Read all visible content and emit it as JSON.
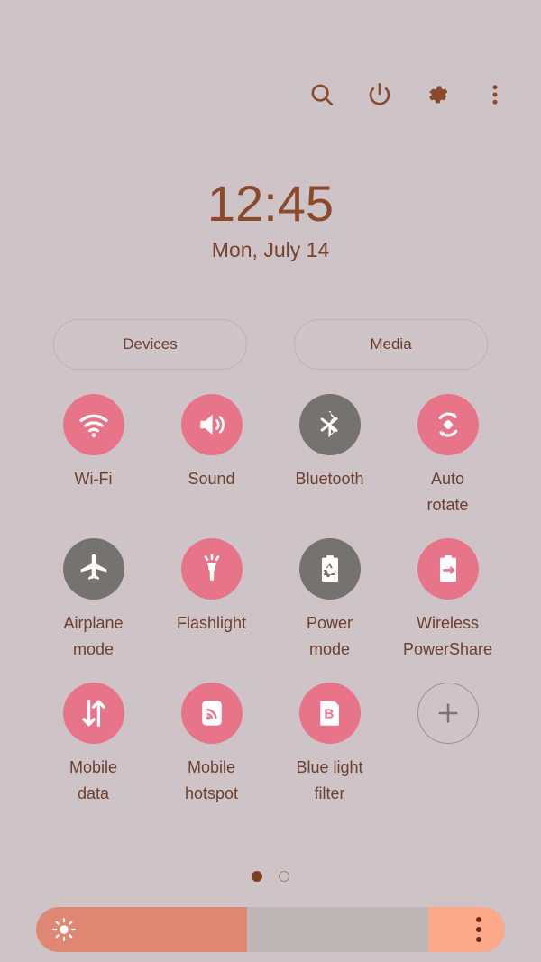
{
  "statusbar": {
    "icons": [
      {
        "name": "search-icon",
        "label": "Search"
      },
      {
        "name": "power-icon",
        "label": "Power off"
      },
      {
        "name": "settings-gear-icon",
        "label": "Settings"
      },
      {
        "name": "more-options-icon",
        "label": "More options"
      }
    ]
  },
  "clock": {
    "time": "12:45",
    "date": "Mon, July 14"
  },
  "pills": {
    "devices_label": "Devices",
    "media_label": "Media"
  },
  "colors": {
    "background": "#cec3c6",
    "tile_on": "#e8748a",
    "tile_off": "#76726f",
    "label_text": "#6b4030",
    "clock_text": "#8a4a2b",
    "slider_fill": "#e08774",
    "slider_track": "#bdb5b6",
    "slider_cap": "#fca989"
  },
  "tiles": [
    {
      "label": "Wi-Fi",
      "icon": "wifi-icon",
      "state": "on"
    },
    {
      "label": "Sound",
      "icon": "sound-icon",
      "state": "on"
    },
    {
      "label": "Bluetooth",
      "icon": "bluetooth-icon",
      "state": "off"
    },
    {
      "label": "Auto\nrotate",
      "icon": "auto-rotate-icon",
      "state": "on"
    },
    {
      "label": "Airplane\nmode",
      "icon": "airplane-icon",
      "state": "off"
    },
    {
      "label": "Flashlight",
      "icon": "flashlight-icon",
      "state": "on"
    },
    {
      "label": "Power\nmode",
      "icon": "power-mode-icon",
      "state": "off"
    },
    {
      "label": "Wireless\nPowerShare",
      "icon": "wireless-powershare-icon",
      "state": "on"
    },
    {
      "label": "Mobile\ndata",
      "icon": "mobile-data-icon",
      "state": "on"
    },
    {
      "label": "Mobile\nhotspot",
      "icon": "mobile-hotspot-icon",
      "state": "on"
    },
    {
      "label": "Blue light\nfilter",
      "icon": "blue-light-filter-icon",
      "state": "on"
    },
    {
      "label": "",
      "icon": "add-icon",
      "state": "add"
    }
  ],
  "pagination": {
    "total": 2,
    "current": 1
  },
  "brightness": {
    "value_percent": 45,
    "icon": "brightness-sun-icon",
    "menu_icon": "slider-more-options-icon"
  }
}
